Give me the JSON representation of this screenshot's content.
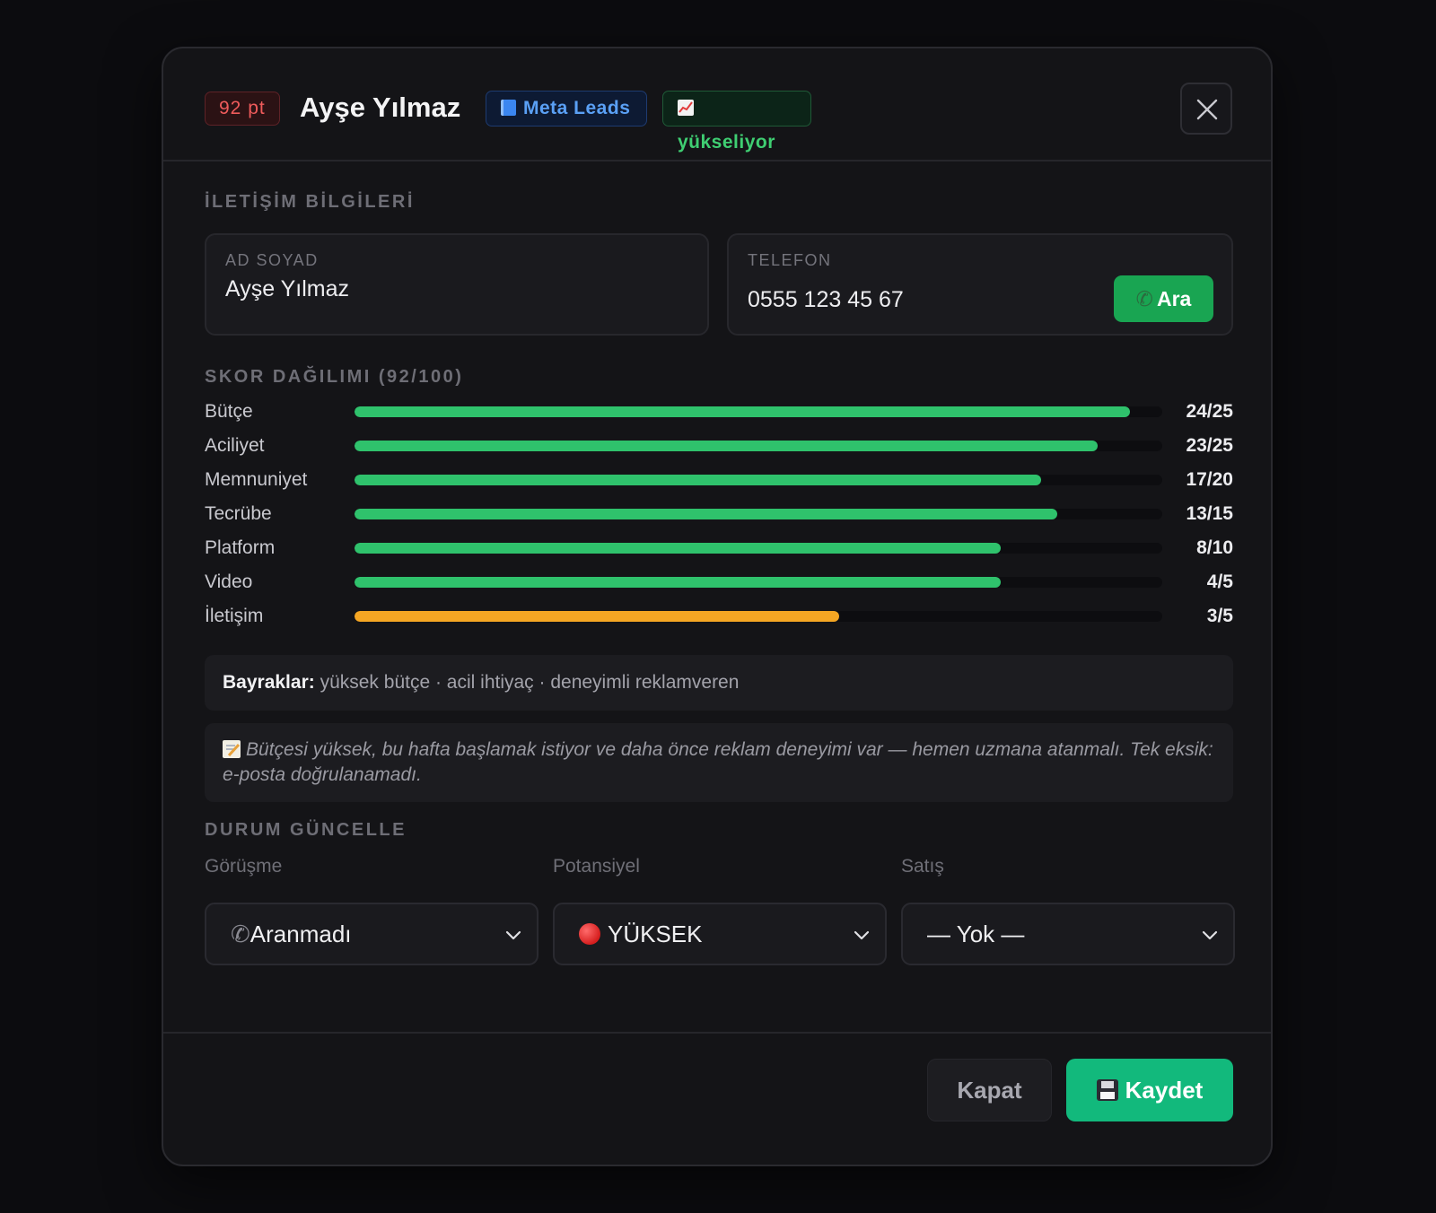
{
  "header": {
    "score_badge": "92 pt",
    "name": "Ayşe Yılmaz",
    "source_badge": "Meta Leads",
    "trend_badge": "yükseliyor"
  },
  "contact": {
    "section_title": "İLETİŞİM BİLGİLERİ",
    "name_label": "AD SOYAD",
    "name_value": "Ayşe Yılmaz",
    "phone_label": "TELEFON",
    "phone_value": "0555 123 45 67",
    "call_button": "Ara"
  },
  "scores": {
    "section_title": "SKOR DAĞILIMI (92/100)",
    "rows": [
      {
        "label": "Bütçe",
        "value": "24/25",
        "fraction": 0.96,
        "color": "#2fc26c"
      },
      {
        "label": "Aciliyet",
        "value": "23/25",
        "fraction": 0.92,
        "color": "#2fc26c"
      },
      {
        "label": "Memnuniyet",
        "value": "17/20",
        "fraction": 0.85,
        "color": "#2fc26c"
      },
      {
        "label": "Tecrübe",
        "value": "13/15",
        "fraction": 0.87,
        "color": "#2fc26c"
      },
      {
        "label": "Platform",
        "value": "8/10",
        "fraction": 0.8,
        "color": "#2fc26c"
      },
      {
        "label": "Video",
        "value": "4/5",
        "fraction": 0.8,
        "color": "#2fc26c"
      },
      {
        "label": "İletişim",
        "value": "3/5",
        "fraction": 0.6,
        "color": "#f5a623"
      }
    ]
  },
  "flags": {
    "label": "Bayraklar:",
    "text": "yüksek bütçe · acil ihtiyaç · deneyimli reklamveren"
  },
  "note": {
    "text": "Bütçesi yüksek, bu hafta başlamak istiyor ve daha önce reklam deneyimi var — hemen uzmana atanmalı. Tek eksik: e-posta doğrulanamadı."
  },
  "status": {
    "section_title": "DURUM GÜNCELLE",
    "call_label": "Görüşme",
    "call_value": "Aranmadı",
    "potential_label": "Potansiyel",
    "potential_value": "YÜKSEK",
    "sale_label": "Satış",
    "sale_value": "— Yok —"
  },
  "footer": {
    "close_button": "Kapat",
    "save_button": "Kaydet"
  }
}
